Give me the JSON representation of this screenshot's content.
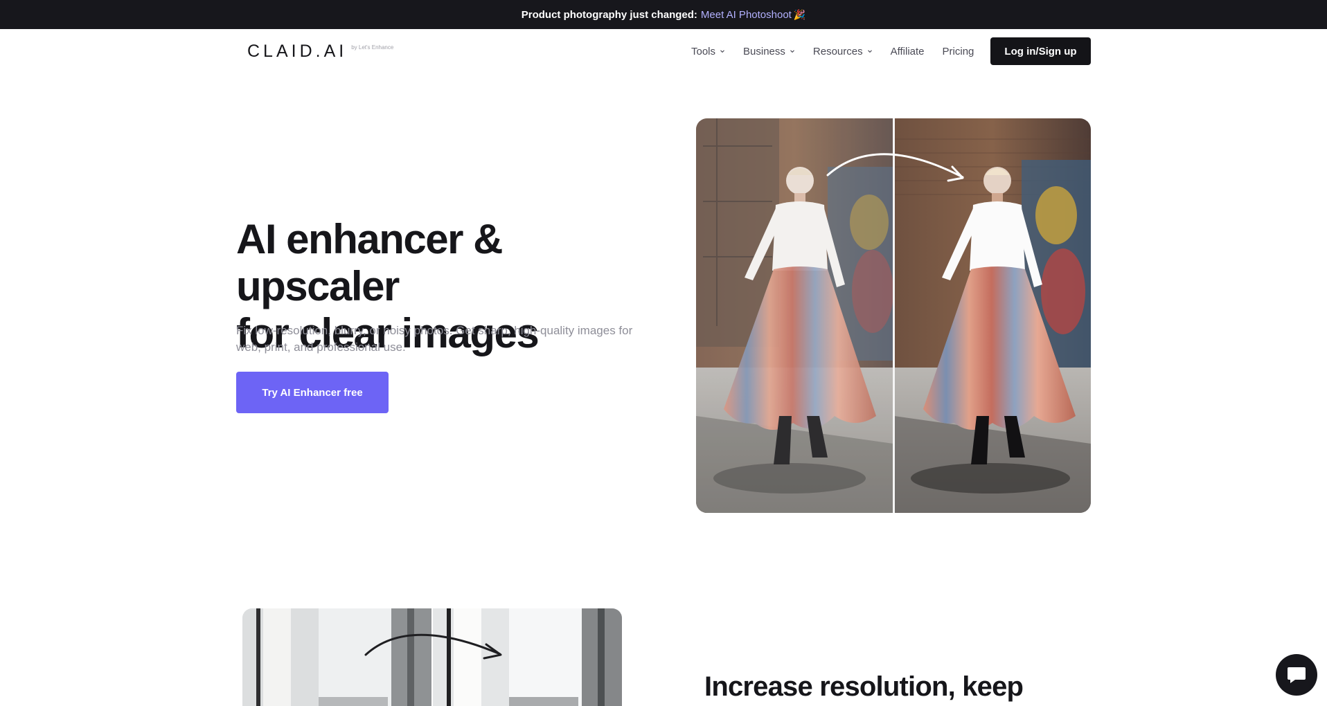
{
  "announcement": {
    "text": "Product photography just changed:",
    "link_text": "Meet AI Photoshoot",
    "emoji": "🎉"
  },
  "nav": {
    "logo_text": "CLAID.AI",
    "logo_byline": "by Let's Enhance",
    "items": [
      {
        "label": "Tools",
        "has_dropdown": true
      },
      {
        "label": "Business",
        "has_dropdown": true
      },
      {
        "label": "Resources",
        "has_dropdown": true
      },
      {
        "label": "Affiliate",
        "has_dropdown": false
      },
      {
        "label": "Pricing",
        "has_dropdown": false
      }
    ],
    "login_label": "Log in/Sign up"
  },
  "hero": {
    "title_line1": "AI enhancer & upscaler",
    "title_line2": "for clear images",
    "subtitle": "Fix low-resolution, blurry, or noisy photos. Get sharp, high-quality images for web, print, and professional use.",
    "cta_label": "Try AI Enhancer free",
    "image_icon": "before-after-fashion-photo"
  },
  "section2": {
    "title": "Increase resolution, keep",
    "image_icon": "before-after-interior-photo"
  },
  "chat": {
    "icon": "chat-bubble-icon"
  },
  "colors": {
    "announcement_bg": "#17171c",
    "announcement_link": "#b3b1ff",
    "cta_bg": "#6d64f5",
    "login_bg": "#141418",
    "subtitle_text": "#8e8e98"
  }
}
